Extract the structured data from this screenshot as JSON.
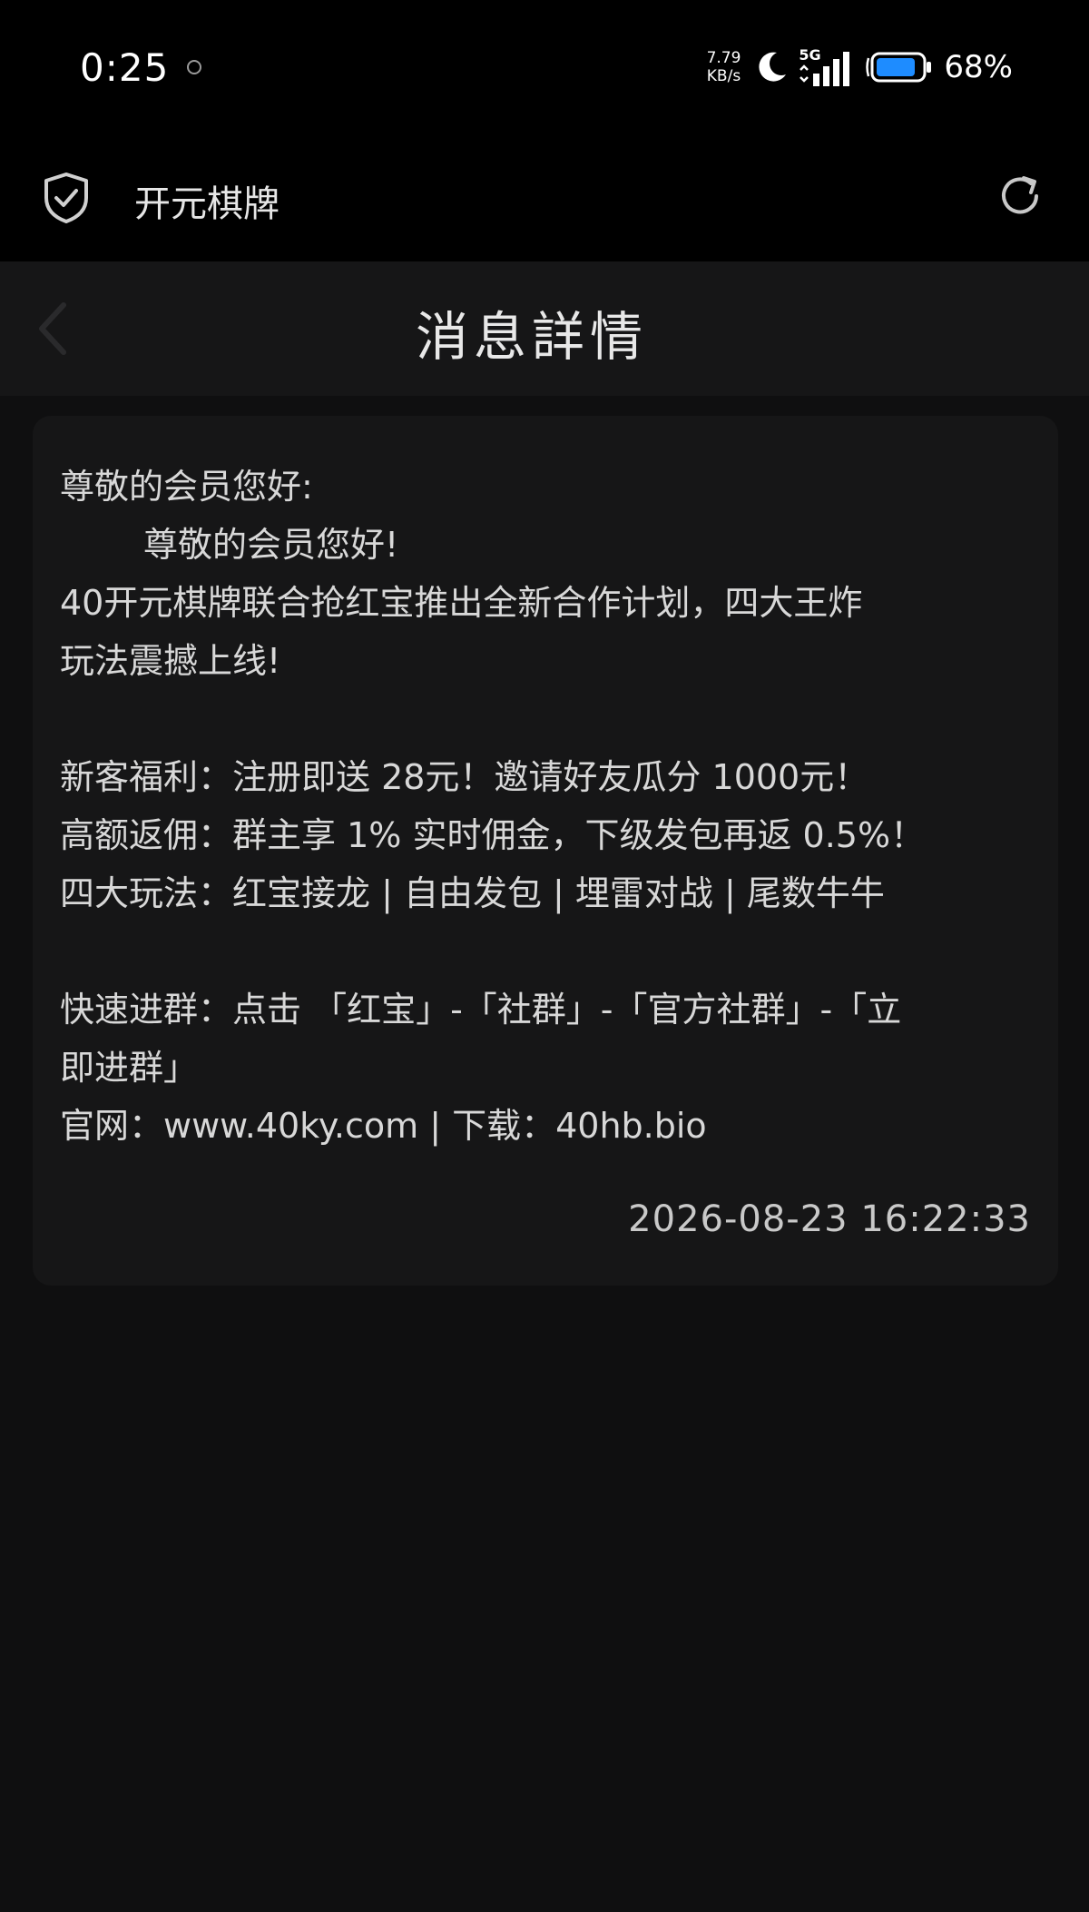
{
  "status_bar": {
    "time": "0:25",
    "net_speed_value": "7.79",
    "net_speed_unit": "KB/s",
    "network": "5G",
    "battery": "68%"
  },
  "app_bar": {
    "title": "开元棋牌",
    "left_icon": "shield-check-icon",
    "right_icon": "refresh-icon"
  },
  "page_header": {
    "title": "消息詳情",
    "back_icon": "chevron-left-icon"
  },
  "message": {
    "greeting": "尊敬的会员您好:",
    "intro": "尊敬的会员您好!",
    "announce_line1": "40开元棋牌联合抢红宝推出全新合作计划，四大王炸",
    "announce_line2": "玩法震撼上线!",
    "welfare": "新客福利：注册即送 28元！邀请好友瓜分 1000元！",
    "commission": "高额返佣：群主享 1% 实时佣金，下级发包再返 0.5%！",
    "gameplay": "四大玩法：红宝接龙 | 自由发包 | 埋雷对战 | 尾数牛牛",
    "join_line1": "快速进群：点击 「红宝」-「社群」-「官方社群」-「立",
    "join_line2": "即进群」",
    "website": "官网：www.40ky.com | 下载：40hb.bio",
    "timestamp": "2026-08-23 16:22:33"
  },
  "colors": {
    "background": "#0f0f10",
    "bar": "#000000",
    "card": "#161617",
    "text": "#d8d8d8"
  }
}
